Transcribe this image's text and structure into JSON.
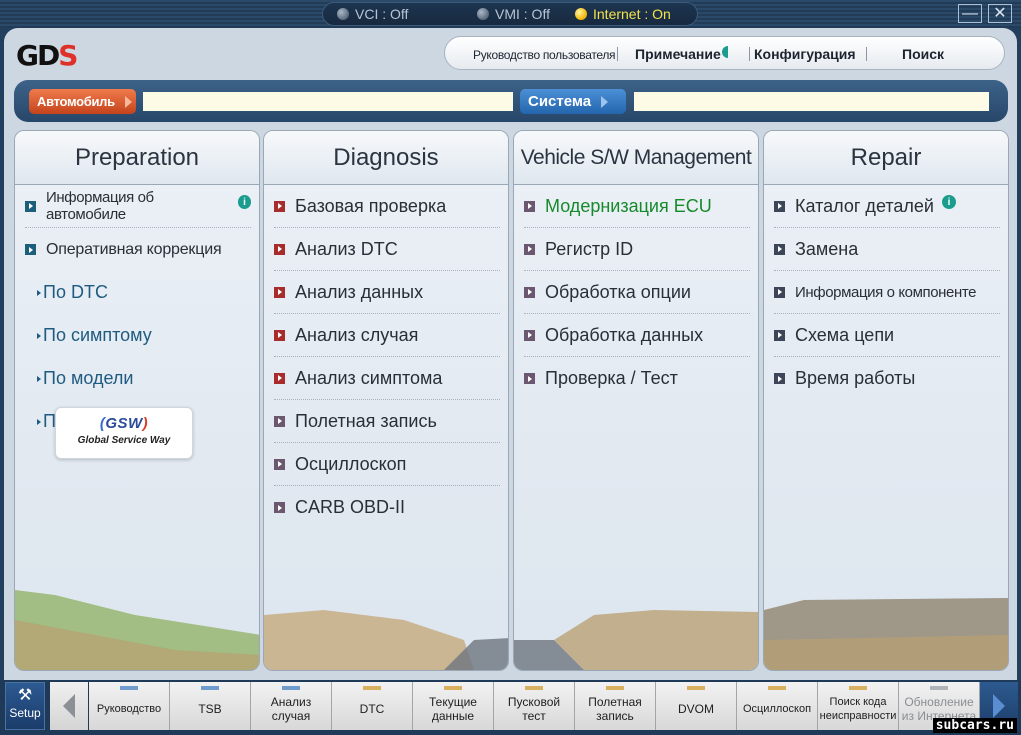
{
  "status": {
    "vci": "VCI : Off",
    "vmi": "VMI : Off",
    "internet": "Internet : On"
  },
  "window": {
    "minimize": "—",
    "close": "✕"
  },
  "logo": {
    "gd": "GD",
    "s": "S"
  },
  "topnav": {
    "user_guide": "Руководство пользователя",
    "note": "Примечание",
    "config": "Конфигурация",
    "search": "Поиск"
  },
  "selector": {
    "vehicle_label": "Автомобиль",
    "vehicle_value": "",
    "system_label": "Система",
    "system_value": ""
  },
  "panels": [
    {
      "title": "Preparation",
      "items": [
        {
          "label": "Информация об автомобиле",
          "info": true
        },
        {
          "label": "Оперативная коррекция"
        }
      ],
      "subitems": [
        "По DTC",
        "По симптому",
        "По модели",
        "По VIN"
      ]
    },
    {
      "title": "Diagnosis",
      "items": [
        {
          "label": "Базовая проверка"
        },
        {
          "label": "Анализ DTC"
        },
        {
          "label": "Анализ данных"
        },
        {
          "label": "Анализ случая"
        },
        {
          "label": "Анализ симптома"
        },
        {
          "label": "Полетная запись"
        },
        {
          "label": "Осциллоскоп"
        },
        {
          "label": "CARB OBD-II"
        }
      ]
    },
    {
      "title": "Vehicle S/W Management",
      "items": [
        {
          "label": "Модернизация ECU",
          "active": true
        },
        {
          "label": "Регистр ID"
        },
        {
          "label": "Обработка опции"
        },
        {
          "label": "Обработка данных"
        },
        {
          "label": "Проверка / Тест"
        }
      ]
    },
    {
      "title": "Repair",
      "items": [
        {
          "label": "Каталог деталей",
          "info": true
        },
        {
          "label": "Замена"
        },
        {
          "label": "Информация о компоненте"
        },
        {
          "label": "Схема цепи"
        },
        {
          "label": "Время работы"
        }
      ]
    }
  ],
  "gsw": {
    "mark": "GSW",
    "tagline": "Global Service Way"
  },
  "toolbar": {
    "setup": "Setup",
    "items": [
      {
        "l1": "Руководство",
        "l2": "",
        "color": "#6f9ccc"
      },
      {
        "l1": "TSB",
        "l2": "",
        "color": "#6f9ccc"
      },
      {
        "l1": "Анализ",
        "l2": "случая",
        "color": "#6f9ccc"
      },
      {
        "l1": "DTC",
        "l2": "",
        "color": "#d8b060"
      },
      {
        "l1": "Текущие",
        "l2": "данные",
        "color": "#d8b060"
      },
      {
        "l1": "Пусковой",
        "l2": "тест",
        "color": "#d8b060"
      },
      {
        "l1": "Полетная",
        "l2": "запись",
        "color": "#d8b060"
      },
      {
        "l1": "DVOM",
        "l2": "",
        "color": "#d8b060"
      },
      {
        "l1": "Осциллоскоп",
        "l2": "",
        "color": "#d8b060"
      },
      {
        "l1": "Поиск кода",
        "l2": "неисправности",
        "color": "#d8b060"
      },
      {
        "l1": "Обновление",
        "l2": "из Интернета",
        "color": "#b0b4b8",
        "disabled": true
      }
    ]
  },
  "watermark": "subcars.ru"
}
